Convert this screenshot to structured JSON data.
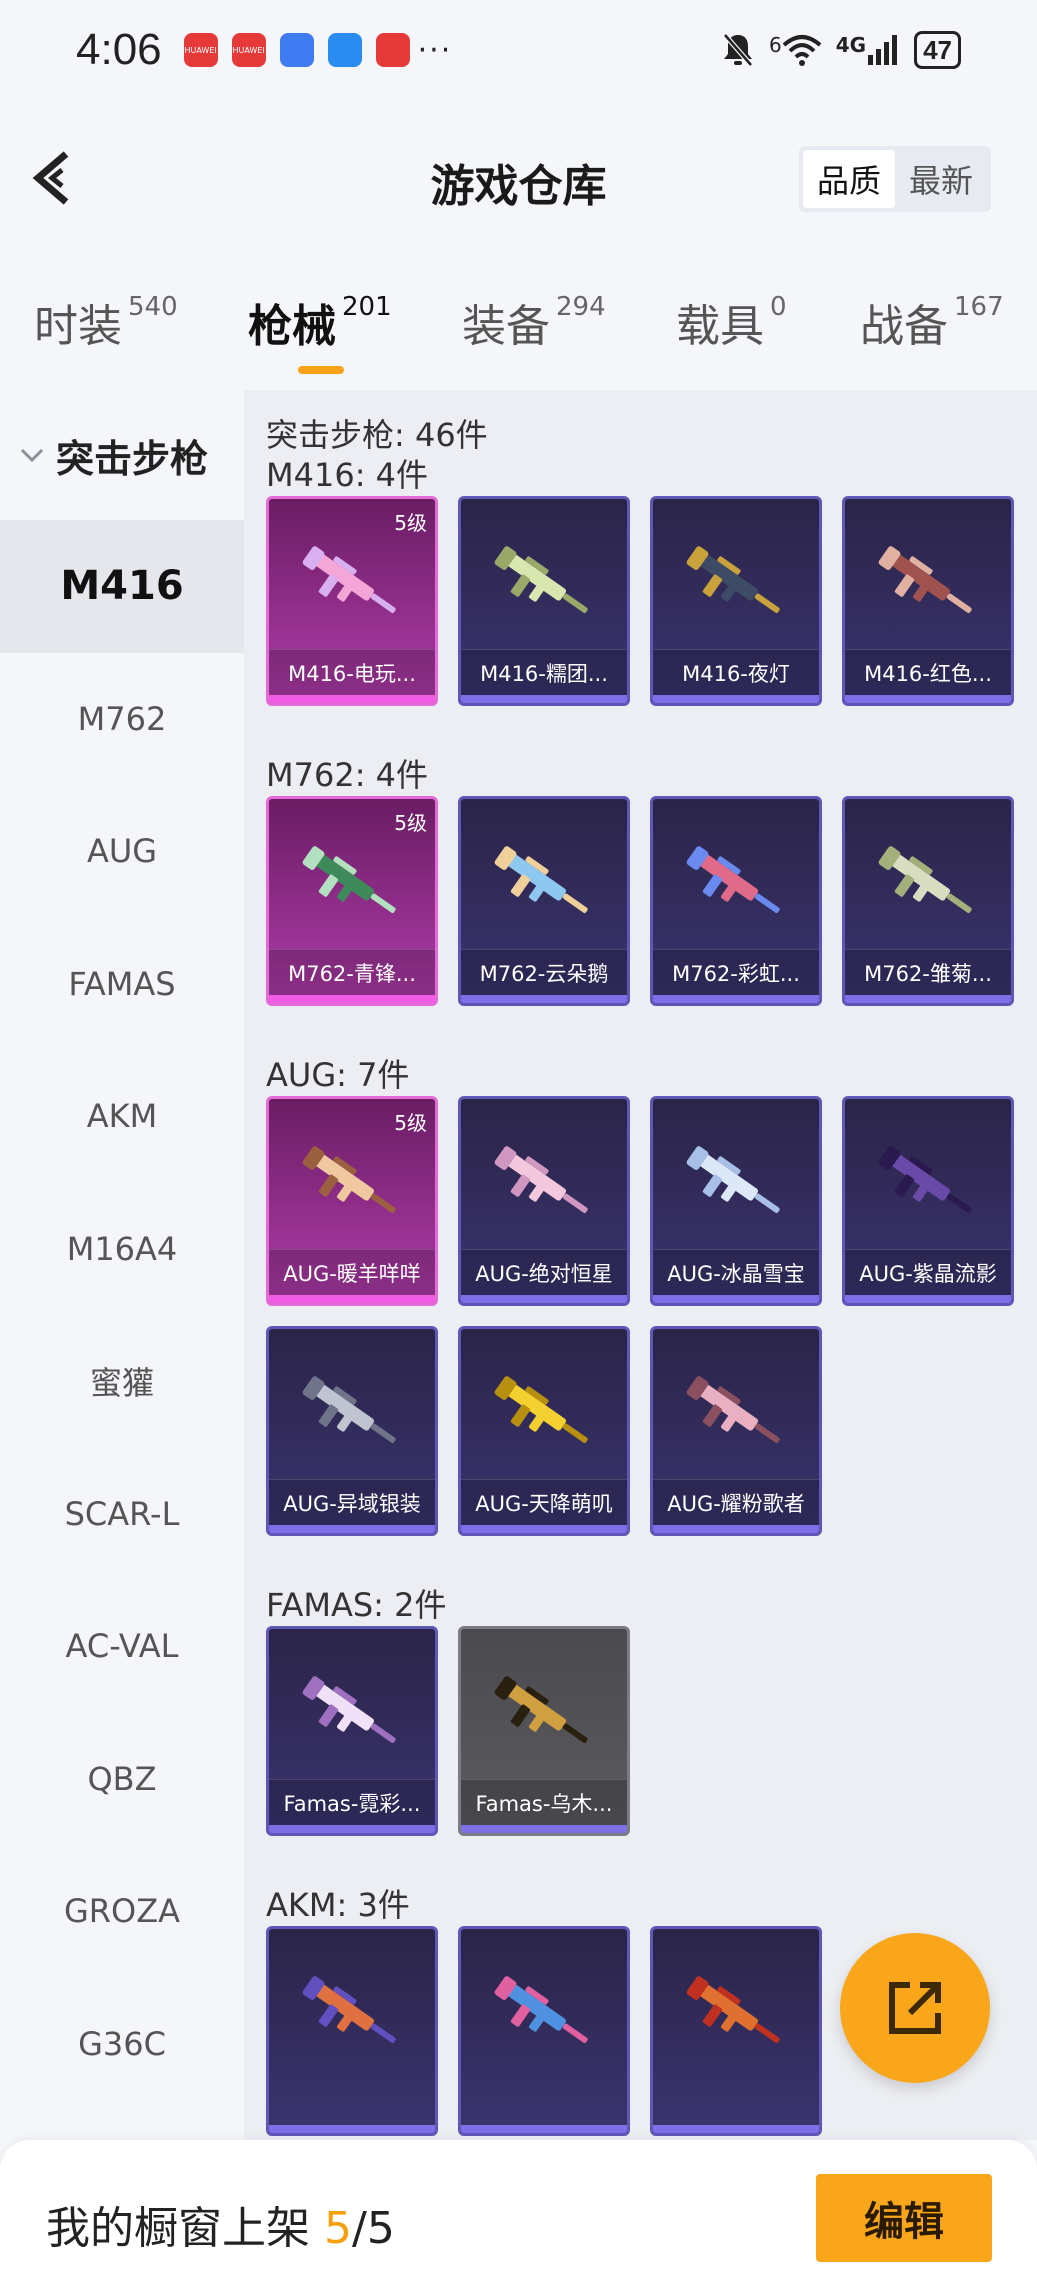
{
  "status": {
    "time": "4:06",
    "notifications": [
      {
        "name": "huawei-icon",
        "color": "#e63a3a",
        "label": "HUAWEI"
      },
      {
        "name": "huawei-icon",
        "color": "#e63a3a",
        "label": "HUAWEI"
      },
      {
        "name": "browser-icon",
        "color": "#3f7cf2",
        "label": ""
      },
      {
        "name": "weather-icon",
        "color": "#2a8cf0",
        "label": ""
      },
      {
        "name": "app-icon",
        "color": "#e63a3a",
        "label": ""
      }
    ],
    "more": "···",
    "network": "4G",
    "wifi_sup": "6",
    "battery": "47"
  },
  "header": {
    "title": "游戏仓库",
    "sort_options": [
      "品质",
      "最新"
    ],
    "sort_active": 0
  },
  "tabs": [
    {
      "label": "时装",
      "count": "540"
    },
    {
      "label": "枪械",
      "count": "201"
    },
    {
      "label": "装备",
      "count": "294"
    },
    {
      "label": "载具",
      "count": "0"
    },
    {
      "label": "战备",
      "count": "167"
    }
  ],
  "active_tab": 1,
  "sidebar": {
    "group": "突击步枪",
    "items": [
      "M416",
      "M762",
      "AUG",
      "FAMAS",
      "AKM",
      "M16A4",
      "蜜獾",
      "SCAR-L",
      "AC-VAL",
      "QBZ",
      "GROZA",
      "G36C"
    ],
    "active": 0
  },
  "main": {
    "total": "突击步枪: 46件",
    "groups": [
      {
        "title": "M416: 4件",
        "items": [
          {
            "name": "M416-电玩...",
            "level": "5级",
            "rarity": "legend"
          },
          {
            "name": "M416-糯团...",
            "rarity": "epic"
          },
          {
            "name": "M416-夜灯",
            "rarity": "epic"
          },
          {
            "name": "M416-红色...",
            "rarity": "epic"
          }
        ]
      },
      {
        "title": "M762: 4件",
        "items": [
          {
            "name": "M762-青锋...",
            "level": "5级",
            "rarity": "legend"
          },
          {
            "name": "M762-云朵鹅",
            "rarity": "epic"
          },
          {
            "name": "M762-彩虹...",
            "rarity": "epic"
          },
          {
            "name": "M762-雏菊...",
            "rarity": "epic"
          }
        ]
      },
      {
        "title": "AUG: 7件",
        "items": [
          {
            "name": "AUG-暖羊咩咩",
            "level": "5级",
            "rarity": "legend"
          },
          {
            "name": "AUG-绝对恒星",
            "rarity": "epic"
          },
          {
            "name": "AUG-冰晶雪宝",
            "rarity": "epic"
          },
          {
            "name": "AUG-紫晶流影",
            "rarity": "epic"
          },
          {
            "name": "AUG-异域银装",
            "rarity": "epic"
          },
          {
            "name": "AUG-天降萌叽",
            "rarity": "epic"
          },
          {
            "name": "AUG-耀粉歌者",
            "rarity": "epic"
          }
        ]
      },
      {
        "title": "FAMAS: 2件",
        "items": [
          {
            "name": "Famas-霓彩...",
            "rarity": "epic"
          },
          {
            "name": "Famas-乌木...",
            "rarity": "gray"
          }
        ]
      },
      {
        "title": "AKM: 3件",
        "items": [
          {
            "name": "",
            "rarity": "epic"
          },
          {
            "name": "",
            "rarity": "epic"
          },
          {
            "name": "",
            "rarity": "epic"
          }
        ]
      }
    ]
  },
  "footer": {
    "label": "我的橱窗上架 ",
    "count_current": "5",
    "count_sep": "/",
    "count_total": "5",
    "edit_label": "编辑"
  },
  "colors": {
    "accent": "#f9a61a",
    "legend": "#d650c8",
    "epic": "#6a5fd6"
  }
}
